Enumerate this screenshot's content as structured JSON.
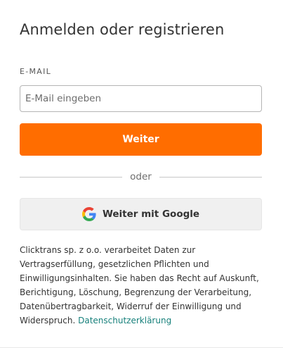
{
  "auth": {
    "title": "Anmelden oder registrieren",
    "email_label": "E-MAIL",
    "email_placeholder": "E-Mail eingeben",
    "email_value": "",
    "continue_label": "Weiter",
    "divider_text": "oder",
    "google_label": "Weiter mit Google",
    "google_icon": "google-g-icon",
    "legal_text": "Clicktrans sp. z o.o. verarbeitet Daten zur Vertragserfüllung, gesetzlichen Pflichten und Einwilligungsinhalten. Sie haben das Recht auf Auskunft, Berichtigung, Löschung, Begrenzung der Verarbeitung, Datenübertragbarkeit, Widerruf der Einwilligung und Widerspruch.",
    "privacy_link": "Datenschutzerklärung"
  },
  "colors": {
    "accent": "#ff6d00",
    "link": "#17807b",
    "google_button_bg": "#f0f0f0"
  }
}
